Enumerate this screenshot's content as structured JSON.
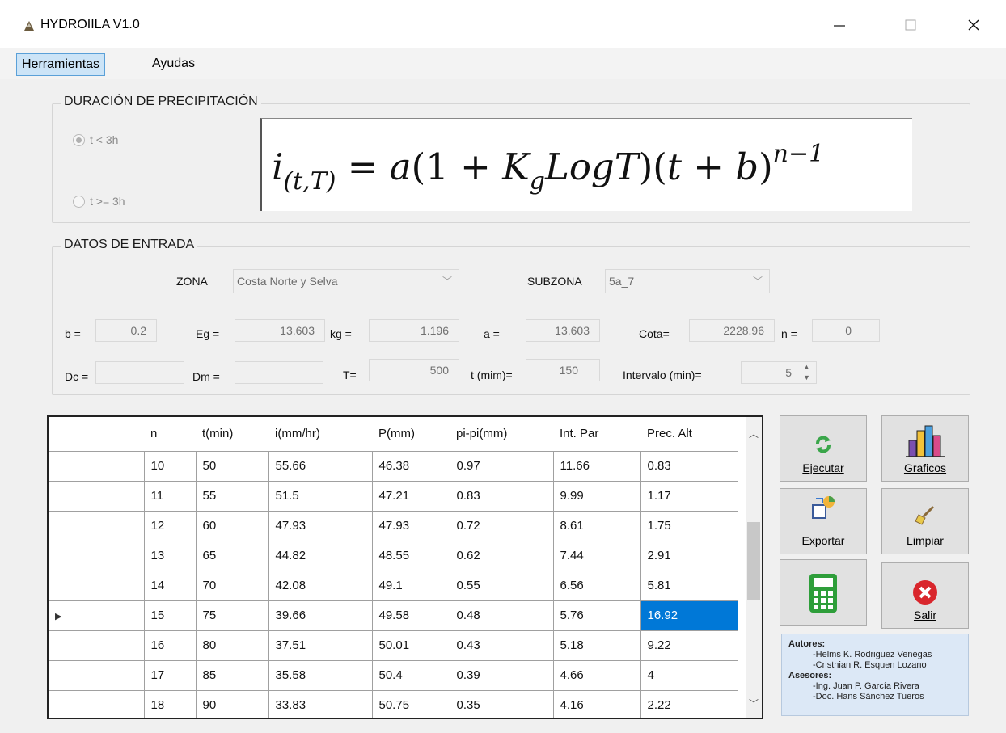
{
  "window": {
    "title": "HYDROIILA V1.0",
    "controls": {
      "minimize": "—",
      "maximize": "☐",
      "close": "✕"
    }
  },
  "menu": {
    "items": [
      "Herramientas",
      "Ayudas"
    ],
    "active": "Herramientas"
  },
  "duration_group": {
    "title": "DURACIÓN DE PRECIPITACIÓN",
    "options": [
      {
        "label": "t < 3h",
        "checked": true,
        "enabled": false
      },
      {
        "label": "t >= 3h",
        "checked": false,
        "enabled": false
      }
    ]
  },
  "formula": "i(t,T) = a(1 + KgLogT)(t + b)^(n−1)",
  "input_group": {
    "title": "DATOS DE ENTRADA",
    "zona_label": "ZONA",
    "zona_value": "Costa Norte y Selva",
    "subzona_label": "SUBZONA",
    "subzona_value": "5a_7",
    "b_label": "b =",
    "b_value": "0.2",
    "eg_label": "Eg =",
    "eg_value": "13.603",
    "kg_label": "kg =",
    "kg_value": "1.196",
    "a_label": "a =",
    "a_value": "13.603",
    "cota_label": "Cota=",
    "cota_value": "2228.96",
    "n_label": "n =",
    "n_value": "0",
    "dc_label": "Dc =",
    "dc_value": "",
    "dm_label": "Dm =",
    "dm_value": "",
    "T_label": "T=",
    "T_value": "500",
    "t_label": "t (mim)=",
    "t_value": "150",
    "intervalo_label": "Intervalo  (min)=",
    "intervalo_value": "5"
  },
  "table": {
    "columns": [
      "n",
      "t(min)",
      "i(mm/hr)",
      "P(mm)",
      "pi-pi(mm)",
      "Int. Par",
      "Prec. Alt"
    ],
    "rows": [
      [
        "10",
        "50",
        "55.66",
        "46.38",
        "0.97",
        "11.66",
        "0.83"
      ],
      [
        "11",
        "55",
        "51.5",
        "47.21",
        "0.83",
        "9.99",
        "1.17"
      ],
      [
        "12",
        "60",
        "47.93",
        "47.93",
        "0.72",
        "8.61",
        "1.75"
      ],
      [
        "13",
        "65",
        "44.82",
        "48.55",
        "0.62",
        "7.44",
        "2.91"
      ],
      [
        "14",
        "70",
        "42.08",
        "49.1",
        "0.55",
        "6.56",
        "5.81"
      ],
      [
        "15",
        "75",
        "39.66",
        "49.58",
        "0.48",
        "5.76",
        "16.92"
      ],
      [
        "16",
        "80",
        "37.51",
        "50.01",
        "0.43",
        "5.18",
        "9.22"
      ],
      [
        "17",
        "85",
        "35.58",
        "50.4",
        "0.39",
        "4.66",
        "4"
      ],
      [
        "18",
        "90",
        "33.83",
        "50.75",
        "0.35",
        "4.16",
        "2.22"
      ]
    ],
    "current_row_index": 5,
    "selected_cell": {
      "row": 5,
      "col": 6
    }
  },
  "buttons": {
    "ejecutar": "Ejecutar",
    "graficos": "Graficos",
    "exportar": "Exportar",
    "limpiar": "Limpiar",
    "salir": "Salir"
  },
  "credits": {
    "autores_title": "Autores:",
    "autores": [
      "-Helms K. Rodriguez Venegas",
      "-Cristhian R. Esquen Lozano"
    ],
    "asesores_title": "Asesores:",
    "asesores": [
      "-Ing. Juan P. García Rivera",
      "-Doc. Hans Sánchez Tueros"
    ]
  },
  "colors": {
    "selection": "#0078d7",
    "menu_active": "#cce4f7",
    "exit_red": "#d9262c",
    "calc_green": "#2e9e3a"
  }
}
